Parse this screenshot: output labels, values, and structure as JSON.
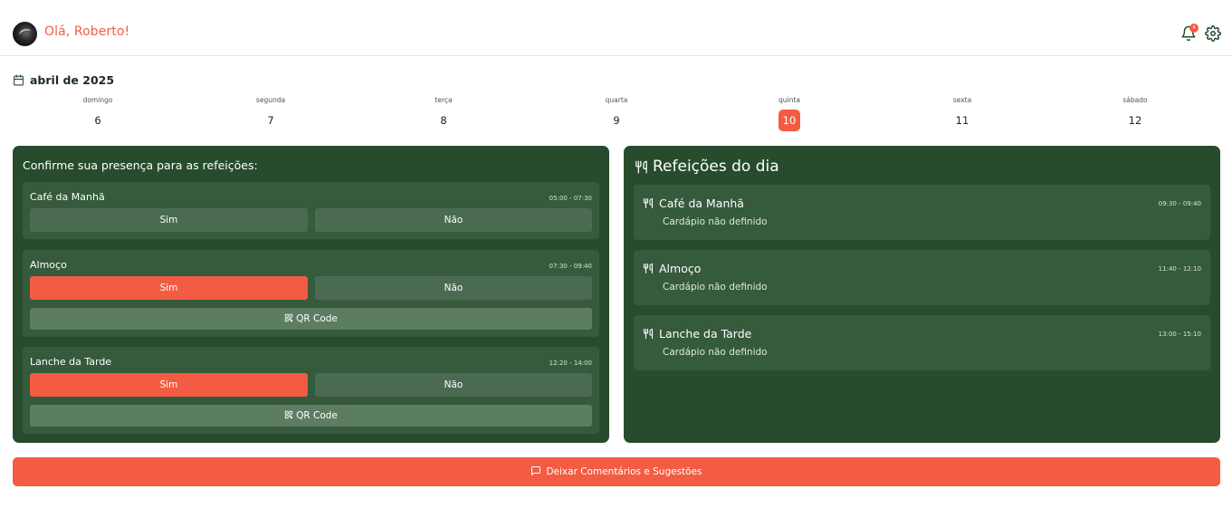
{
  "header": {
    "greeting": "Olá, Roberto!",
    "notification_count": "4",
    "icons": {
      "avatar": "user-avatar",
      "notifications": "bell-icon",
      "settings": "gear-icon"
    },
    "accent_color": "#f35c43"
  },
  "calendar": {
    "month_label": "abril de 2025",
    "icon": "calendar-icon",
    "days": [
      {
        "name": "domingo",
        "number": "6"
      },
      {
        "name": "segunda",
        "number": "7"
      },
      {
        "name": "terça",
        "number": "8"
      },
      {
        "name": "quarta",
        "number": "9"
      },
      {
        "name": "quinta",
        "number": "10"
      },
      {
        "name": "sexta",
        "number": "11"
      },
      {
        "name": "sábado",
        "number": "12"
      }
    ],
    "selected_day": "10"
  },
  "attendance": {
    "title": "Confirme sua presença para as refeições:",
    "meals": [
      {
        "name": "Café da Manhã",
        "time": "05:00 - 07:30",
        "yes_label": "Sim",
        "no_label": "Não",
        "selected": "none"
      },
      {
        "name": "Almoço",
        "time": "07:30 - 09:40",
        "yes_label": "Sim",
        "no_label": "Não",
        "selected": "yes",
        "qr_label": "QR Code"
      },
      {
        "name": "Lanche da Tarde",
        "time": "12:20 - 14:00",
        "yes_label": "Sim",
        "no_label": "Não",
        "selected": "yes",
        "qr_label": "QR Code"
      }
    ]
  },
  "daily_meals": {
    "title": "Refeições do dia",
    "icon": "utensils-icon",
    "meals": [
      {
        "name": "Café da Manhã",
        "time": "09:30 - 09:40",
        "menu": "Cardápio não definido"
      },
      {
        "name": "Almoço",
        "time": "11:40 - 12:10",
        "menu": "Cardápio não definido"
      },
      {
        "name": "Lanche da Tarde",
        "time": "13:00 - 15:10",
        "menu": "Cardápio não definido"
      }
    ]
  },
  "feedback": {
    "label": "Deixar Comentários e Sugestões",
    "icon": "message-icon"
  },
  "colors": {
    "panel": "#264c2d",
    "card": "#355a3c",
    "button": "#4a6b51",
    "qr_button": "#5d7d63",
    "accent": "#f35c43"
  }
}
